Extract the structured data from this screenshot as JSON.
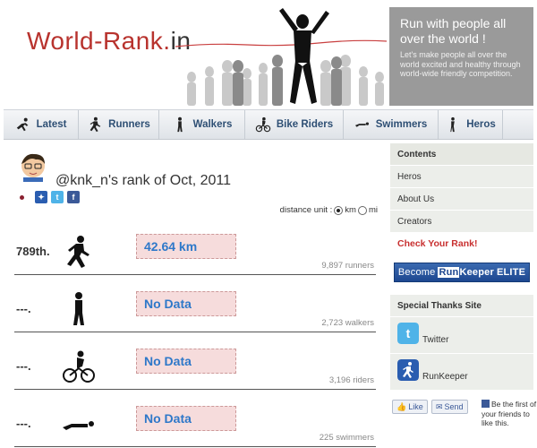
{
  "header": {
    "logo_world": "World-",
    "logo_rank": "Rank.",
    "logo_in": "in",
    "hero_title": "Run with people all over the world !",
    "hero_subtitle": "Let's make people all over the world excited and healthy through world-wide friendly competition."
  },
  "nav": {
    "items": [
      {
        "label": "Latest",
        "icon": "runner-lean-icon"
      },
      {
        "label": "Runners",
        "icon": "runner-icon"
      },
      {
        "label": "Walkers",
        "icon": "walker-icon"
      },
      {
        "label": "Bike Riders",
        "icon": "bike-icon"
      },
      {
        "label": "Swimmers",
        "icon": "swimmer-icon"
      },
      {
        "label": "Heros",
        "icon": "hero-icon"
      }
    ]
  },
  "main": {
    "title": "@knk_n's rank of Oct, 2011",
    "distance_unit_label": "distance unit :",
    "unit_km": "km",
    "unit_mi": "mi",
    "stats": [
      {
        "rank": "789th.",
        "value": "42.64 km",
        "count": "9,897 runners",
        "icon": "runner-icon"
      },
      {
        "rank": "---.",
        "value": "No Data",
        "count": "2,723 walkers",
        "icon": "walker-icon"
      },
      {
        "rank": "---.",
        "value": "No Data",
        "count": "3,196 riders",
        "icon": "bike-icon"
      },
      {
        "rank": "---.",
        "value": "No Data",
        "count": "225 swimmers",
        "icon": "swimmer-icon"
      }
    ]
  },
  "sidebar": {
    "contents_heading": "Contents",
    "items": [
      "Heros",
      "About Us",
      "Creators"
    ],
    "check_rank": "Check Your Rank!",
    "banner_become": "Become",
    "banner_run": "Run",
    "banner_keeper": "Keeper",
    "banner_elite": "ELITE",
    "thanks_heading": "Special Thanks Site",
    "thanks": [
      {
        "label": "Twitter",
        "icon": "twitter-icon"
      },
      {
        "label": "RunKeeper",
        "icon": "runkeeper-icon"
      }
    ],
    "like_label": "Like",
    "send_label": "Send",
    "fb_text": "Be the first of your friends to like this."
  },
  "colors": {
    "brand_red": "#b8332e",
    "nav_text": "#2e4f74",
    "value_blue": "#2e78c9",
    "value_bg": "#f6dcdc",
    "check_red": "#c83030"
  }
}
